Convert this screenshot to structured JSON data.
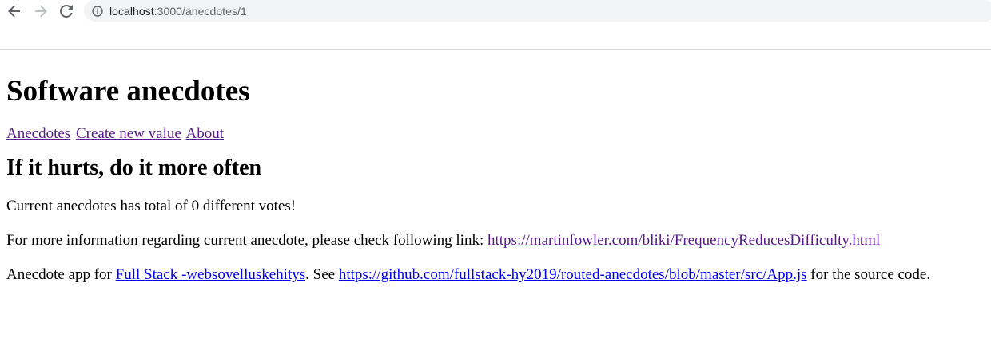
{
  "browser": {
    "url_host": "localhost",
    "url_rest": ":3000/anecdotes/1"
  },
  "page": {
    "title": "Software anecdotes",
    "nav": {
      "anecdotes": "Anecdotes",
      "create": "Create new value",
      "about": "About"
    },
    "anecdote": {
      "heading": "If it hurts, do it more often",
      "votes_text": "Current anecdotes has total of 0 different votes!",
      "info_prefix": "For more information regarding current anecdote, please check following link: ",
      "info_link": "https://martinfowler.com/bliki/FrequencyReducesDifficulty.html"
    },
    "footer": {
      "prefix": "Anecdote app for ",
      "course_link": "Full Stack -websovelluskehitys",
      "middle": ". See ",
      "source_link": "https://github.com/fullstack-hy2019/routed-anecdotes/blob/master/src/App.js",
      "suffix": " for the source code."
    }
  },
  "colors": {
    "visited_link": "#551a8b",
    "unvisited_link": "#0000ee",
    "omnibox_bg": "#f1f3f4"
  }
}
